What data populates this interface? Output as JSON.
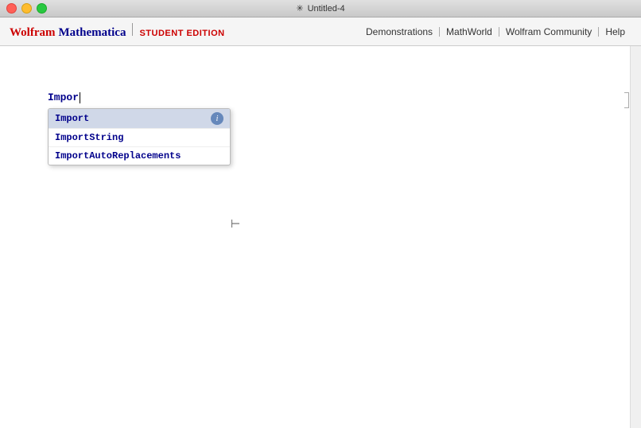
{
  "titleBar": {
    "title": "Untitled-4",
    "icon": "✳"
  },
  "brand": {
    "wolfram": "Wolfram",
    "mathematica": "Mathematica",
    "edition": "STUDENT EDITION"
  },
  "nav": {
    "links": [
      {
        "label": "Demonstrations"
      },
      {
        "label": "MathWorld"
      },
      {
        "label": "Wolfram Community"
      },
      {
        "label": "Help"
      }
    ]
  },
  "input": {
    "text": "Impor"
  },
  "autocomplete": {
    "items": [
      {
        "label": "Import",
        "selected": true,
        "showInfo": true
      },
      {
        "label": "ImportString",
        "selected": false,
        "showInfo": false
      },
      {
        "label": "ImportAutoReplacements",
        "selected": false,
        "showInfo": false
      }
    ]
  },
  "infoIcon": "i"
}
